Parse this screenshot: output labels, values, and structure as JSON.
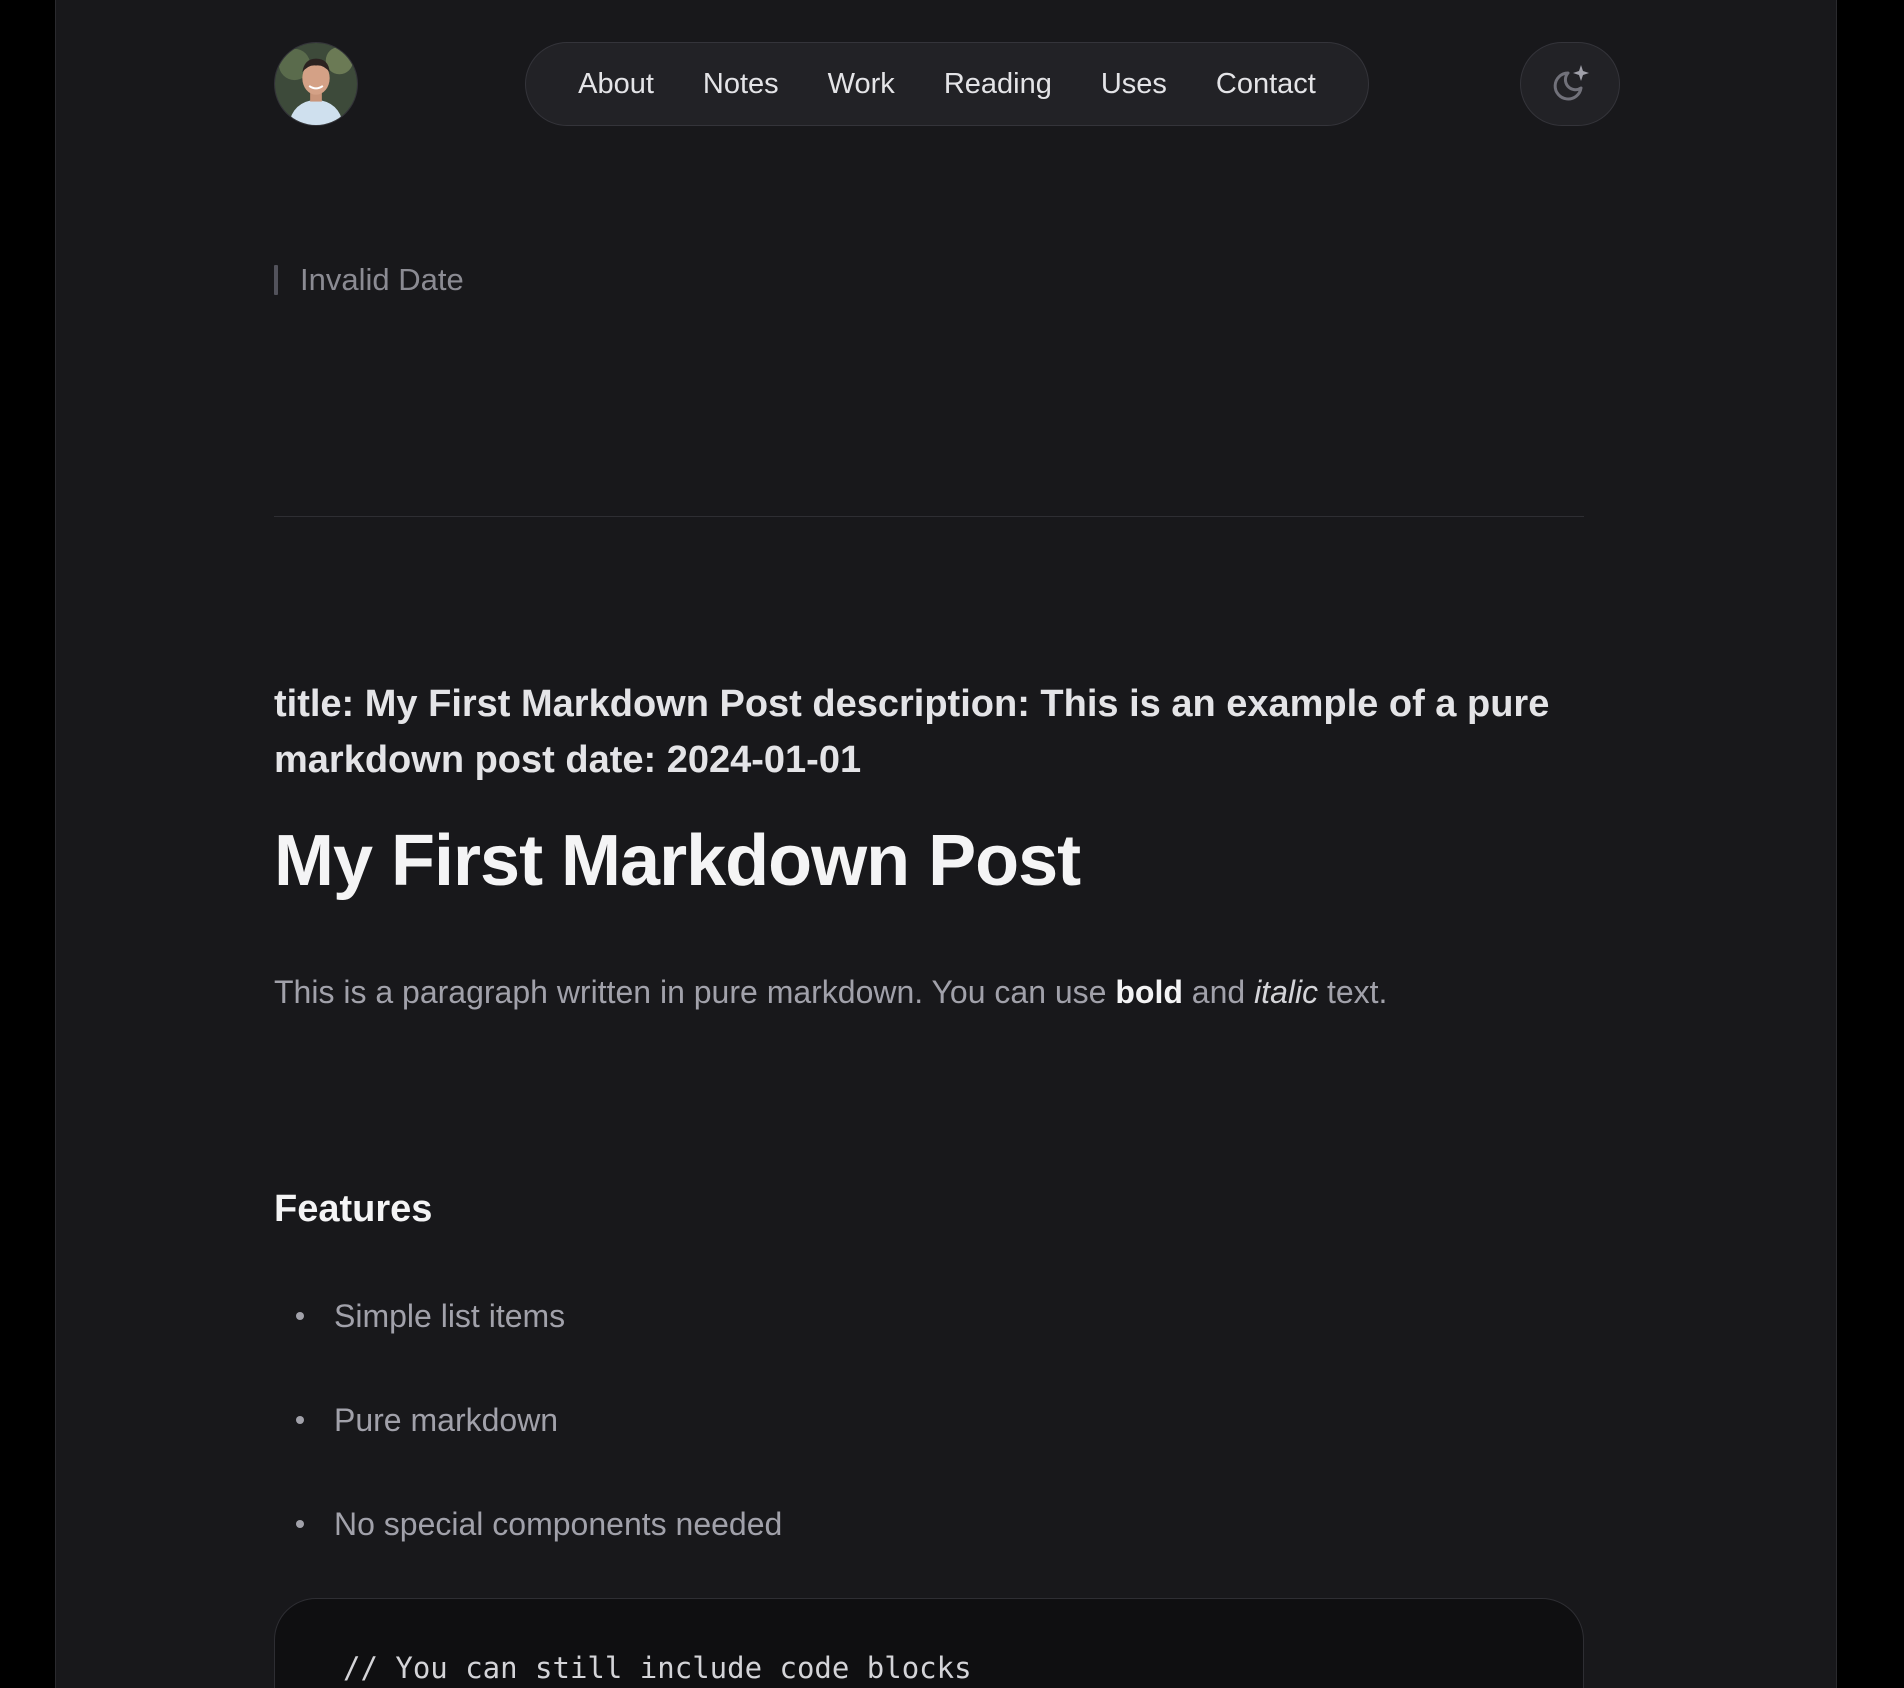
{
  "nav": {
    "items": [
      {
        "label": "About"
      },
      {
        "label": "Notes"
      },
      {
        "label": "Work"
      },
      {
        "label": "Reading"
      },
      {
        "label": "Uses"
      },
      {
        "label": "Contact"
      }
    ]
  },
  "icons": {
    "avatar": "avatar-portrait",
    "theme_toggle": "moon-sparkle-icon"
  },
  "post": {
    "date": "Invalid Date",
    "frontmatter": "title: My First Markdown Post description: This is an example of a pure markdown post date: 2024-01-01",
    "heading": "My First Markdown Post",
    "paragraph": {
      "before": "This is a paragraph written in pure markdown. You can use ",
      "bold": "bold",
      "middle": " and ",
      "italic": "italic",
      "after": " text."
    },
    "features_heading": "Features",
    "features": [
      "Simple list items",
      "Pure markdown",
      "No special components needed"
    ],
    "code": "// You can still include code blocks"
  },
  "colors": {
    "background": "#18181b",
    "outer": "#000000",
    "text_primary": "#f4f4f5",
    "text_muted": "#a1a1aa"
  }
}
